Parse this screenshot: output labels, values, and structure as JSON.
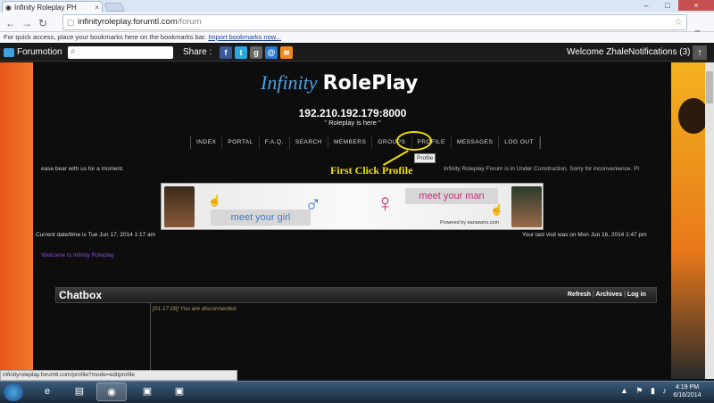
{
  "browser": {
    "tab_title": "Infinity Roleplay PH",
    "url_host": "infinityroleplay.forumtl.com",
    "url_path": "/forum",
    "bookmarks_msg": "For quick access, place your bookmarks here on the bookmarks bar.",
    "import_link": "Import bookmarks now..."
  },
  "forumbar": {
    "brand": "Forumotion",
    "share_label": "Share :",
    "welcome": "Welcome Zhale",
    "notifications": "Notifications (3)"
  },
  "site": {
    "logo_part1": "Infinity",
    "logo_part2": "RolePlay",
    "server_ip": "192.210.192.179:8000",
    "tagline": "\" Roleplay is here \"",
    "nav": [
      "Index",
      "Portal",
      "F.A.Q.",
      "Search",
      "Members",
      "Groups",
      "Profile",
      "Messages",
      "Log out"
    ],
    "tooltip": "Profile",
    "annotation": "First Click Profile",
    "scroll_msg": "ease bear with us for a moment.",
    "construction_msg": "Infinity Roleplay Forum is in Under Construction. Sorry for inconvenience. Pl",
    "ad_girl": "meet your girl",
    "ad_man": "meet your man",
    "ad_powered": "Powered by eanswers.com",
    "current_datetime": "Current date/time is Tue Jun 17, 2014 1:17 am",
    "last_visit": "Your last visit was on Mon Jun 16, 2014 1:47 pm",
    "welcome_msg": "Welcome to Infinity Roleplay"
  },
  "chatbox": {
    "title": "Chatbox",
    "refresh": "Refresh",
    "archives": "Archives",
    "login": "Log in",
    "message_time": "[01:17:08]",
    "message_text": "You are disconnected."
  },
  "status_url": "infinityroleplay.forumtl.com/profile?mode=editprofile",
  "taskbar": {
    "time": "4:19 PM",
    "date": "6/16/2014"
  },
  "colors": {
    "logo_blue": "#4aa3e0",
    "annotation_yellow": "#f0e000",
    "welcome_purple": "#8a4ad8"
  }
}
